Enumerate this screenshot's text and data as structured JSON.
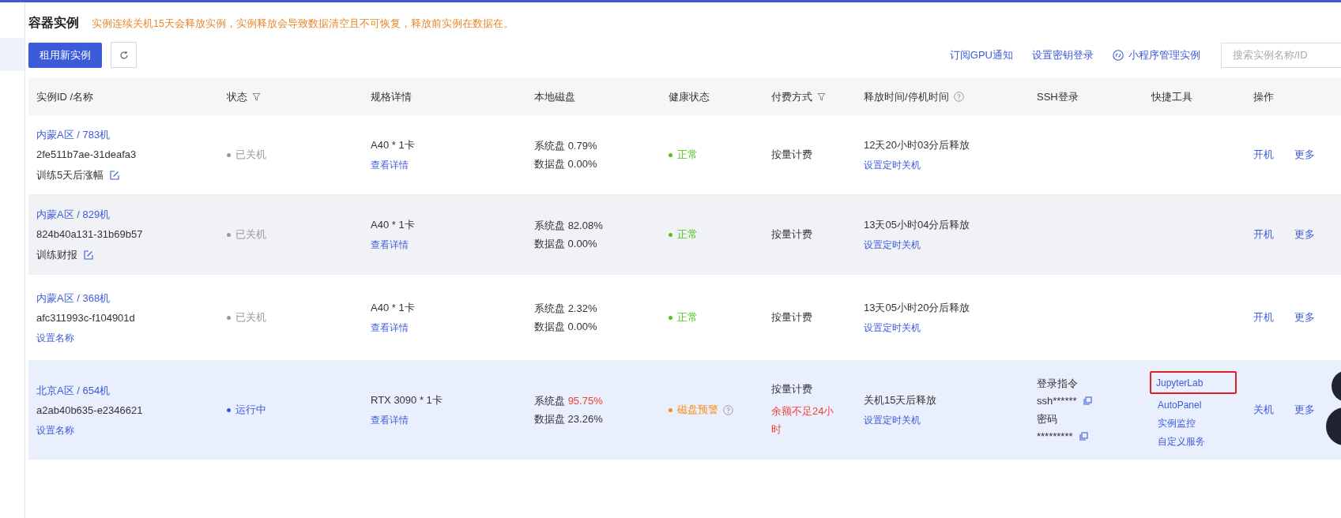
{
  "page": {
    "title": "容器实例",
    "notice": "实例连续关机15天会释放实例，实例释放会导致数据清空且不可恢复，释放前实例在数据在。"
  },
  "toolbar": {
    "new_button": "租用新实例",
    "links": [
      {
        "label": "订阅GPU通知",
        "kind": "plain"
      },
      {
        "label": "设置密钥登录",
        "kind": "plain"
      },
      {
        "label": "小程序管理实例",
        "kind": "icon"
      }
    ],
    "search": {
      "placeholder": "搜索实例名称/ID"
    }
  },
  "table": {
    "columns": [
      {
        "label": "实例ID /名称",
        "kind": "plain"
      },
      {
        "label": "状态",
        "kind": "filter"
      },
      {
        "label": "规格详情",
        "kind": "plain"
      },
      {
        "label": "本地磁盘",
        "kind": "plain"
      },
      {
        "label": "健康状态",
        "kind": "plain"
      },
      {
        "label": "付费方式",
        "kind": "filter"
      },
      {
        "label": "释放时间/停机时间",
        "kind": "help"
      },
      {
        "label": "SSH登录",
        "kind": "plain"
      },
      {
        "label": "快捷工具",
        "kind": "plain"
      },
      {
        "label": "操作",
        "kind": "plain"
      }
    ],
    "rows": [
      {
        "selected": false,
        "hovered": false,
        "region": "内蒙A区 / 783机",
        "id": "2fe511b7ae-31deafa3",
        "name": {
          "kind": "text",
          "label": "训练5天后涨幅"
        },
        "status": {
          "kind": "off",
          "label": "已关机"
        },
        "spec": "A40 * 1卡",
        "spec_link": "查看详情",
        "disk": {
          "system_label": "系统盘",
          "system": "0.79%",
          "system_warning": false,
          "data": "数据盘 0.00%"
        },
        "health": {
          "kind": "ok",
          "label": "正常"
        },
        "billing": {
          "label": "按量计费"
        },
        "release": {
          "label": "12天20小时03分后释放",
          "link": "设置定时关机"
        },
        "tools": [],
        "actions": [
          "开机",
          "更多"
        ]
      },
      {
        "selected": false,
        "hovered": true,
        "region": "内蒙A区 / 829机",
        "id": "824b40a131-31b69b57",
        "name": {
          "kind": "text",
          "label": "训练财报"
        },
        "status": {
          "kind": "off",
          "label": "已关机"
        },
        "spec": "A40 * 1卡",
        "spec_link": "查看详情",
        "disk": {
          "system_label": "系统盘",
          "system": "82.08%",
          "system_warning": false,
          "data": "数据盘 0.00%"
        },
        "health": {
          "kind": "ok",
          "label": "正常"
        },
        "billing": {
          "label": "按量计费"
        },
        "release": {
          "label": "13天05小时04分后释放",
          "link": "设置定时关机"
        },
        "tools": [],
        "actions": [
          "开机",
          "更多"
        ]
      },
      {
        "selected": false,
        "hovered": false,
        "region": "内蒙A区 / 368机",
        "id": "afc311993c-f104901d",
        "name": {
          "kind": "link",
          "label": "设置名称"
        },
        "status": {
          "kind": "off",
          "label": "已关机"
        },
        "spec": "A40 * 1卡",
        "spec_link": "查看详情",
        "disk": {
          "system_label": "系统盘",
          "system": "2.32%",
          "system_warning": false,
          "data": "数据盘 0.00%"
        },
        "health": {
          "kind": "ok",
          "label": "正常"
        },
        "billing": {
          "label": "按量计费"
        },
        "release": {
          "label": "13天05小时20分后释放",
          "link": "设置定时关机"
        },
        "tools": [],
        "actions": [
          "开机",
          "更多"
        ]
      },
      {
        "selected": true,
        "hovered": false,
        "region": "北京A区 / 654机",
        "id": "a2ab40b635-e2346621",
        "name": {
          "kind": "link",
          "label": "设置名称"
        },
        "status": {
          "kind": "running",
          "label": "运行中"
        },
        "spec": "RTX 3090 * 1卡",
        "spec_link": "查看详情",
        "disk": {
          "system_label": "系统盘",
          "system": "95.75%",
          "system_warning": true,
          "data": "数据盘 23.26%"
        },
        "health": {
          "kind": "warn",
          "label": "磁盘预警"
        },
        "billing": {
          "label": "按量计费",
          "warning": "余额不足24小时"
        },
        "release": {
          "label": "关机15天后释放",
          "link": "设置定时关机"
        },
        "ssh": {
          "command_label": "登录指令",
          "command": "ssh******",
          "password_label": "密码",
          "password": "*********"
        },
        "tools": [
          {
            "label": "JupyterLab",
            "highlighted": true
          },
          {
            "label": "AutoPanel",
            "highlighted": false
          },
          {
            "label": "实例监控",
            "highlighted": false
          },
          {
            "label": "自定义服务",
            "highlighted": false
          }
        ],
        "actions": [
          "关机",
          "更多"
        ]
      }
    ]
  }
}
